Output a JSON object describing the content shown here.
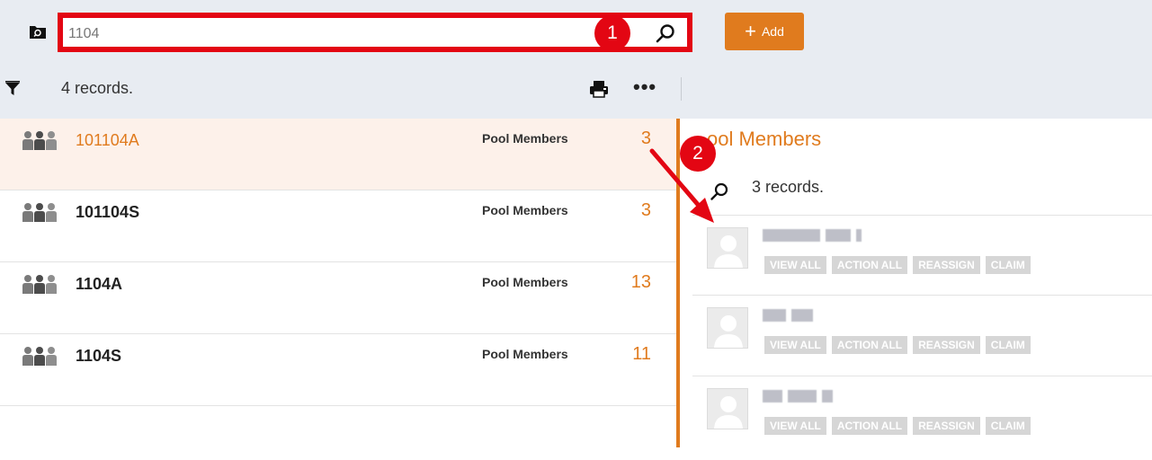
{
  "header": {
    "search": {
      "value": "1104",
      "placeholder": ""
    },
    "add_button": {
      "label": "Add"
    },
    "annotations": {
      "callout_1": "1",
      "callout_2": "2"
    }
  },
  "toolbar": {
    "records_label": "4 records."
  },
  "list": {
    "rows": [
      {
        "name": "101104A",
        "type": "Pool Members",
        "count": "3",
        "selected": true
      },
      {
        "name": "101104S",
        "type": "Pool Members",
        "count": "3",
        "selected": false
      },
      {
        "name": "1104A",
        "type": "Pool Members",
        "count": "13",
        "selected": false
      },
      {
        "name": "1104S",
        "type": "Pool Members",
        "count": "11",
        "selected": false
      }
    ]
  },
  "panel": {
    "title": "ool Members",
    "records_label": "3 records.",
    "member_actions": [
      "VIEW ALL",
      "ACTION ALL",
      "REASSIGN",
      "CLAIM"
    ]
  },
  "colors": {
    "accent": "#e07b1e",
    "annotation": "#e30613",
    "header_bg": "#e8ecf2",
    "selected_row_bg": "#fdf1ea",
    "action_button_bg": "#d6d6d6"
  },
  "icons": [
    "folder-search-icon",
    "search-icon",
    "plus-icon",
    "filter-icon",
    "print-icon",
    "more-icon",
    "group-icon",
    "avatar-icon"
  ]
}
